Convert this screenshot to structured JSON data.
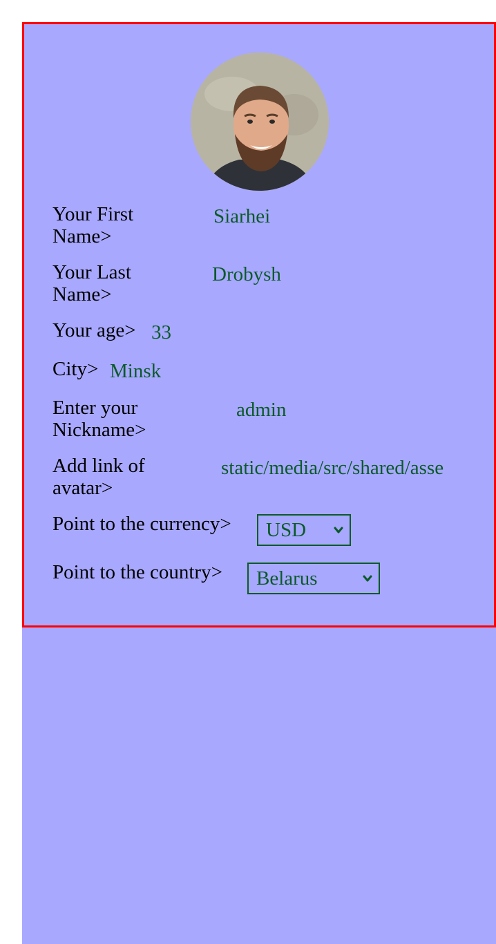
{
  "profile": {
    "first_name_label": "Your First Name>",
    "first_name_value": "Siarhei",
    "last_name_label": "Your Last Name>",
    "last_name_value": "Drobysh",
    "age_label": "Your age>",
    "age_value": "33",
    "city_label": "City>",
    "city_value": "Minsk",
    "nickname_label": "Enter your Nickname>",
    "nickname_value": "admin",
    "avatar_link_label": "Add link of avatar>",
    "avatar_link_value": "static/media/src/shared/asse",
    "currency_label": "Point to the currency>",
    "currency_value": "USD",
    "country_label": "Point to the country>",
    "country_value": "Belarus"
  },
  "icons": {
    "avatar": "avatar-photo",
    "dropdown": "chevron-down-icon"
  },
  "colors": {
    "page_background": "#a8a8ff",
    "card_border": "#ff0000",
    "value_text": "#0b5a29",
    "label_text": "#000000"
  }
}
